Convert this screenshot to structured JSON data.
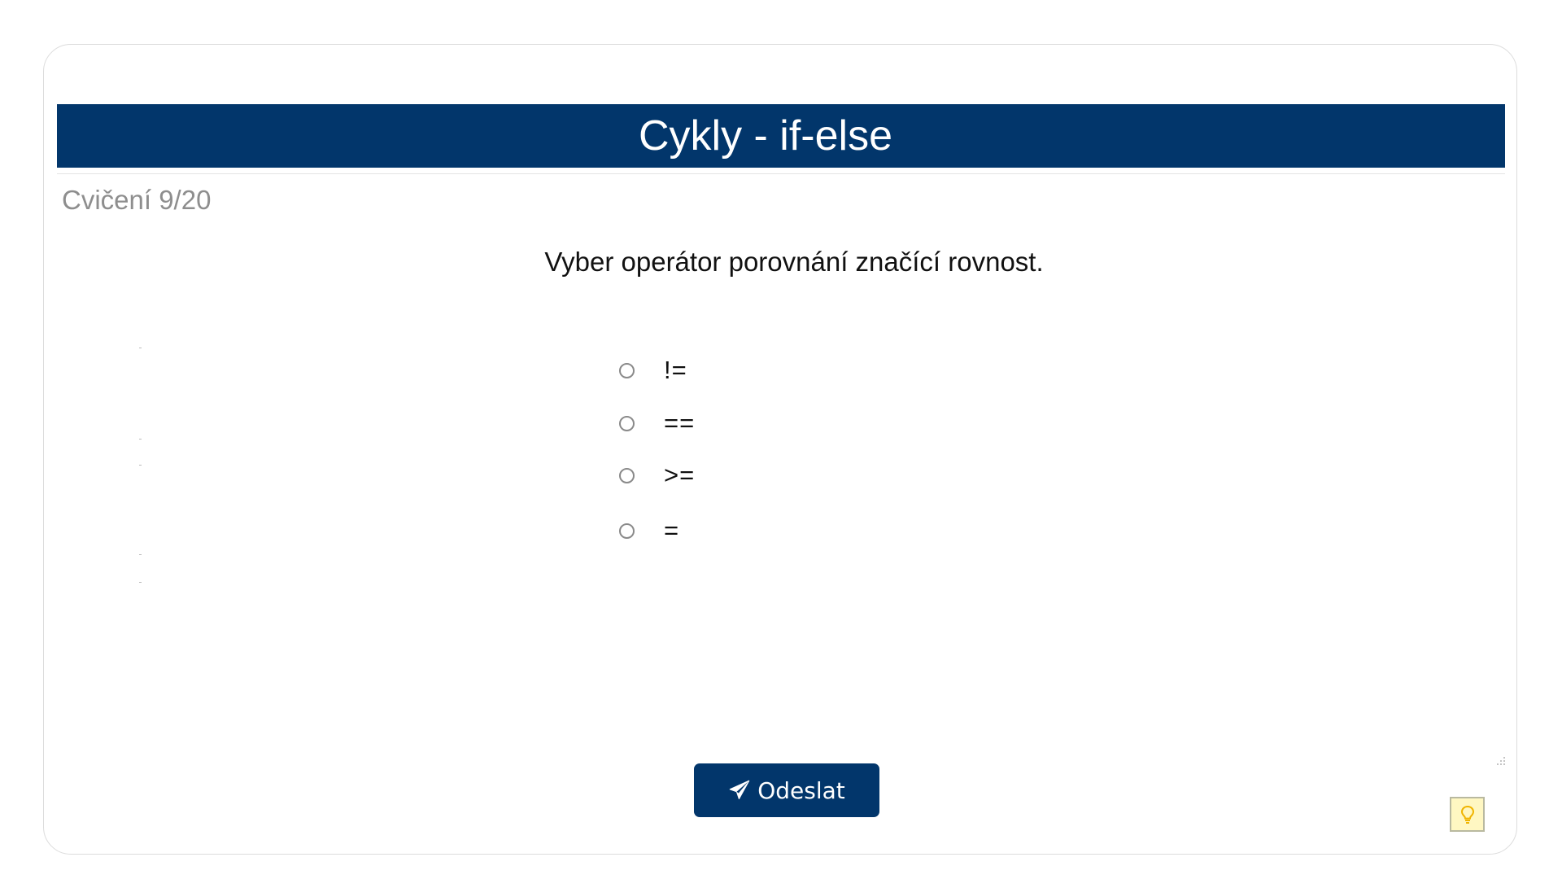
{
  "header": {
    "title": "Cykly - if-else"
  },
  "exercise": {
    "counter": "Cvičení 9/20",
    "question": "Vyber operátor porovnání značící rovnost.",
    "options": [
      {
        "label": "!=",
        "selected": false
      },
      {
        "label": "==",
        "selected": false
      },
      {
        "label": ">=",
        "selected": false
      },
      {
        "label": "=",
        "selected": false
      }
    ]
  },
  "actions": {
    "submit_label": "Odeslat",
    "submit_icon": "paper-plane-icon",
    "hint_icon": "lightbulb-icon"
  },
  "colors": {
    "header_bg": "#02366b",
    "button_bg": "#02366b",
    "hint_bg": "#fff7c2",
    "counter_text": "#8e8e8e"
  }
}
